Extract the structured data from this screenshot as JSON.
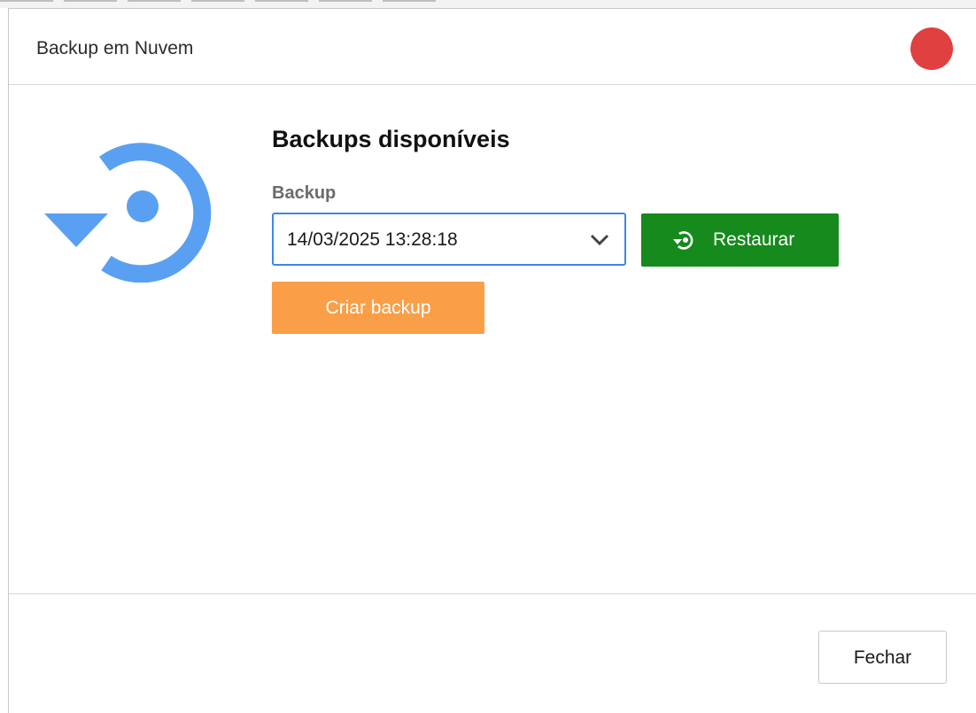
{
  "dialog": {
    "title": "Backup em Nuvem"
  },
  "main": {
    "section_title": "Backups disponíveis",
    "backup_label": "Backup",
    "selected_backup": "14/03/2025 13:28:18",
    "restore_label": "Restaurar",
    "create_label": "Criar backup"
  },
  "footer": {
    "close_label": "Fechar"
  },
  "colors": {
    "accent_blue": "#3e86e8",
    "icon_blue": "#5aa0f2",
    "restore_green": "#168a1c",
    "create_orange": "#fa9e47",
    "close_red": "#e04040"
  },
  "icons": {
    "main": "restore-icon",
    "select": "chevron-down-icon",
    "restore": "restore-icon",
    "window_close": "close-icon"
  }
}
